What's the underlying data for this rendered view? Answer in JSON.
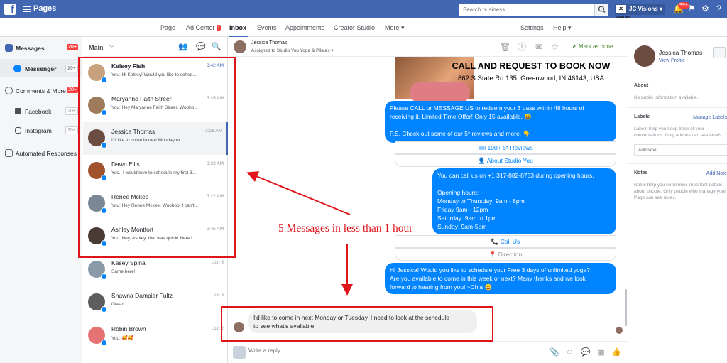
{
  "topbar": {
    "title": "Pages",
    "search_placeholder": "Search business",
    "account_name": "JC Visions",
    "account_logo": "JC VISIONS",
    "notification_badge": "99+"
  },
  "nav": {
    "items": [
      "Page",
      "Ad Center",
      "Inbox",
      "Events",
      "Appointments",
      "Creator Studio",
      "More",
      "Settings",
      "Help"
    ],
    "ad_center_badge": "!",
    "active": "Inbox"
  },
  "leftnav": {
    "messages": {
      "label": "Messages",
      "count": "20+"
    },
    "messenger": {
      "label": "Messenger",
      "count": "20+"
    },
    "comments": {
      "label": "Comments & More",
      "count": "20+"
    },
    "facebook": {
      "label": "Facebook",
      "count": "20+"
    },
    "instagram": {
      "label": "Instagram",
      "count": "20+"
    },
    "automated": {
      "label": "Automated Responses"
    }
  },
  "convlist": {
    "header": "Main",
    "conversations": [
      {
        "name": "Kelsey Fish",
        "time": "3:42 AM",
        "preview": "You: Hi Kelsey! Would you like to sched...",
        "unread": true,
        "avatar_color": "#c8a27c"
      },
      {
        "name": "Maryanne Faith Streer",
        "time": "3:35 AM",
        "preview": "You: Hey Maryanne Faith Streer. Wooho...",
        "unread": false,
        "avatar_color": "#9e7b5a"
      },
      {
        "name": "Jessica Thomas",
        "time": "3:28 AM",
        "preview": "I'd like to come in next Monday or...",
        "unread": false,
        "avatar_color": "#6d4c41"
      },
      {
        "name": "Dawn Ellis",
        "time": "3:23 AM",
        "preview": "Yes.. I would love to schedule my first 3...",
        "unread": false,
        "avatar_color": "#a0522d"
      },
      {
        "name": "Renee Mckee",
        "time": "3:22 AM",
        "preview": "You: Hey Renee Mckee. Woohoo! I can't...",
        "unread": false,
        "avatar_color": "#7b8794"
      },
      {
        "name": "Ashley Montfort",
        "time": "2:45 AM",
        "preview": "You: Hey, Ashley, that was quick! Here i...",
        "unread": false,
        "avatar_color": "#4a3b35"
      },
      {
        "name": "Kasey Spina",
        "time": "Jun 5",
        "preview": "Same here!!",
        "unread": false,
        "avatar_color": "#8a9aa8"
      },
      {
        "name": "Shawna Dampier Fultz",
        "time": "Jun 3",
        "preview": "Great!",
        "unread": false,
        "avatar_color": "#5d5d5d"
      },
      {
        "name": "Robin Brown",
        "time": "Jun 2",
        "preview": "You: 🥰🥰",
        "unread": false,
        "avatar_color": "#e57373"
      }
    ]
  },
  "thread": {
    "name": "Jessica Thomas",
    "assigned": "Assigned to Studio You Yoga & Pilates ▾",
    "mark_done": "Mark as done",
    "promo_title": "CALL AND REQUEST TO BOOK NOW",
    "promo_address": "862 S State Rd 135, Greenwood, IN 46143, USA",
    "bubble1": [
      "Please CALL or MESSAGE US to redeem your 3 pass within 48 hours of",
      "receiving it. Limited Time Offer! Only 15 available. 😀",
      "",
      "P.S. Check out some of our 5* reviews and more. 👇"
    ],
    "btn_reviews": "🎟 100+ 5* Reviews",
    "btn_about": "👤 About Studio You",
    "bubble2": [
      "You can call us on +1 317-882-8733 during opening hours.",
      "",
      "Opening hours:",
      "Monday to Thursday: 9am - 8pm",
      "Friday 9am - 12pm",
      "Saturday: 9am to 1pm",
      "Sunday: 9am-5pm"
    ],
    "btn_call": "📞 Call Us",
    "btn_direction": "📍 Direction",
    "bubble3": [
      "Hi Jessica! Would you like to schedule your Free 3 days of unlimited yoga?",
      "Are you available to come in this week or next? Many thanks and we look",
      "forward to hearing from you! ~Chia 😀"
    ],
    "incoming": [
      "I'd like to come in next Monday or Tuesday. I need to look at the schedule",
      "to see what's available."
    ],
    "reply_placeholder": "Write a reply..."
  },
  "info": {
    "name": "Jessica Thomas",
    "view_profile": "View Profile",
    "more": "...",
    "about_title": "About",
    "about_text": "No public information available.",
    "labels_title": "Labels",
    "manage_labels": "Manage Labels",
    "labels_text": "Labels help you keep track of your conversations. Only admins can see labels.",
    "add_label": "Add label...",
    "notes_title": "Notes",
    "add_note": "Add Note",
    "notes_text": "Notes help you remember important details about people. Only people who manage your Page can see notes."
  },
  "annotation": {
    "text": "5 Messages in less than 1 hour",
    "color": "#e0141b"
  }
}
